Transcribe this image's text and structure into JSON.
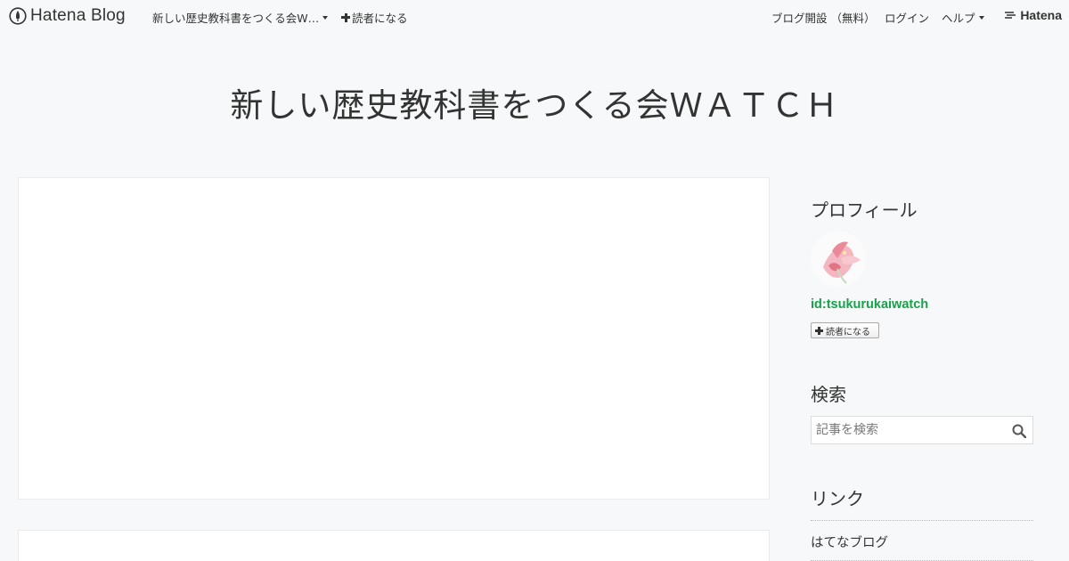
{
  "header": {
    "brand": "Hatena Blog",
    "blog_menu": "新しい歴史教科書をつくる会W…",
    "subscribe": "読者になる",
    "create_blog": "ブログ開設 （無料）",
    "login": "ログイン",
    "help": "ヘルプ",
    "hatena": "Hatena"
  },
  "blog": {
    "title": "新しい歴史教科書をつくる会ＷＡＴＣＨ"
  },
  "sidebar": {
    "profile": {
      "heading": "プロフィール",
      "id": "id:tsukurukaiwatch",
      "subscribe_button": "読者になる"
    },
    "search": {
      "heading": "検索",
      "placeholder": "記事を検索"
    },
    "links": {
      "heading": "リンク",
      "items": [
        "はてなブログ"
      ]
    }
  },
  "colors": {
    "background": "#f7f8f9",
    "card": "#ffffff",
    "profile_link": "#16a34a",
    "text": "#333333"
  }
}
